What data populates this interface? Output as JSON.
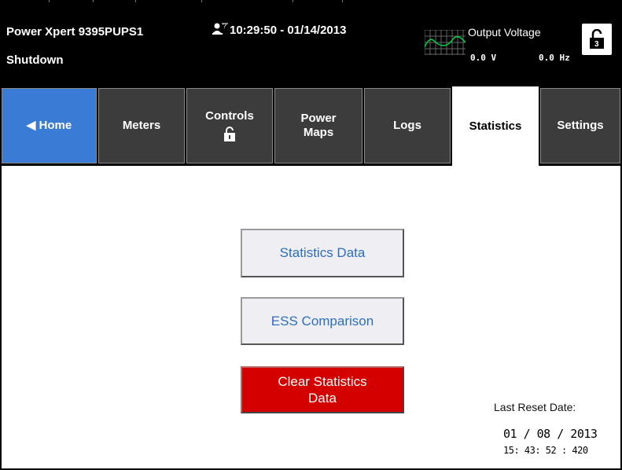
{
  "header": {
    "device_name": "Power Xpert 9395PUPS1",
    "status": "Shutdown",
    "user_icon": "user-question-icon",
    "datetime": "10:29:50 - 01/14/2013",
    "output": {
      "label": "Output Voltage",
      "voltage": "0.0 V",
      "frequency": "0.0 Hz"
    },
    "lock_level": "3"
  },
  "tabs": [
    {
      "label": "◀ Home",
      "state": "home"
    },
    {
      "label": "Meters"
    },
    {
      "label": "Controls",
      "icon": "unlocked-padlock-icon"
    },
    {
      "label_line1": "Power",
      "label_line2": "Maps"
    },
    {
      "label": "Logs"
    },
    {
      "label": "Statistics",
      "state": "active"
    },
    {
      "label": "Settings"
    }
  ],
  "main": {
    "statistics_data_button": "Statistics Data",
    "ess_comparison_button": "ESS Comparison",
    "clear_button_line1": "Clear Statistics",
    "clear_button_line2": "Data",
    "last_reset_label": "Last Reset Date:",
    "last_reset_date": "01 / 08 / 2013",
    "last_reset_time": "15: 43: 52 : 420"
  },
  "colors": {
    "header_bg": "#000000",
    "tab_bg": "#3c3c3c",
    "home_tab_bg": "#3a7bd5",
    "button_text": "#2d6fbf",
    "danger": "#d40000",
    "wave": "#00cc44"
  }
}
